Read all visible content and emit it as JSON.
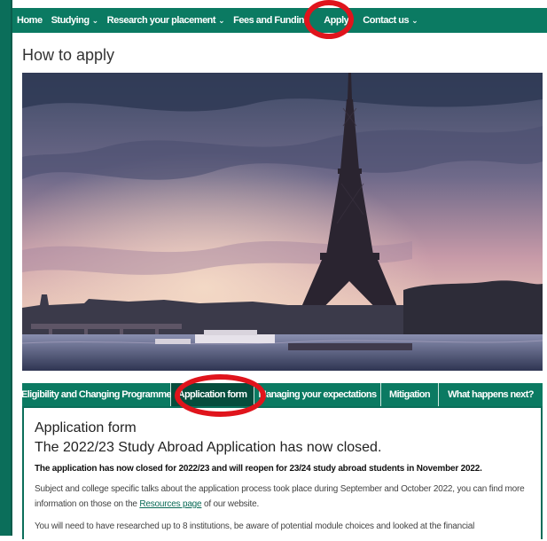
{
  "nav": {
    "items": [
      {
        "label": "Home",
        "chevron": false
      },
      {
        "label": "Studying",
        "chevron": true
      },
      {
        "label": "Research your placement",
        "chevron": true
      },
      {
        "label": "Fees and Funding",
        "chevron": false
      },
      {
        "label": "Apply",
        "chevron": false
      },
      {
        "label": "Contact us",
        "chevron": true
      }
    ],
    "chevron_glyph": "⌄",
    "color": "#0b7a62"
  },
  "page": {
    "title": "How to apply"
  },
  "hero": {
    "image": "eiffel-tower-sunset-photo"
  },
  "tabs": [
    {
      "label": "Eligibility and Changing Programme",
      "active": false
    },
    {
      "label": "Application form",
      "active": true
    },
    {
      "label": "Managing your expectations",
      "active": false
    },
    {
      "label": "Mitigation",
      "active": false
    },
    {
      "label": "What happens next?",
      "active": false
    }
  ],
  "panel": {
    "heading": "Application form",
    "subheading": "The 2022/23 Study Abroad Application has now closed.",
    "bold_notice": "The application has now closed for 2022/23 and will reopen for 23/24 study abroad students in November 2022.",
    "para1_part1": "Subject and college specific talks about the application process took place during September and October 2022, you can find more information on those on the ",
    "para1_link": "Resources page",
    "para1_part2": " of our website.",
    "para2": "You will need to have researched up to 8 institutions, be aware of potential module choices and looked at the financial"
  },
  "annotations": {
    "highlight_color": "#e0141c"
  }
}
